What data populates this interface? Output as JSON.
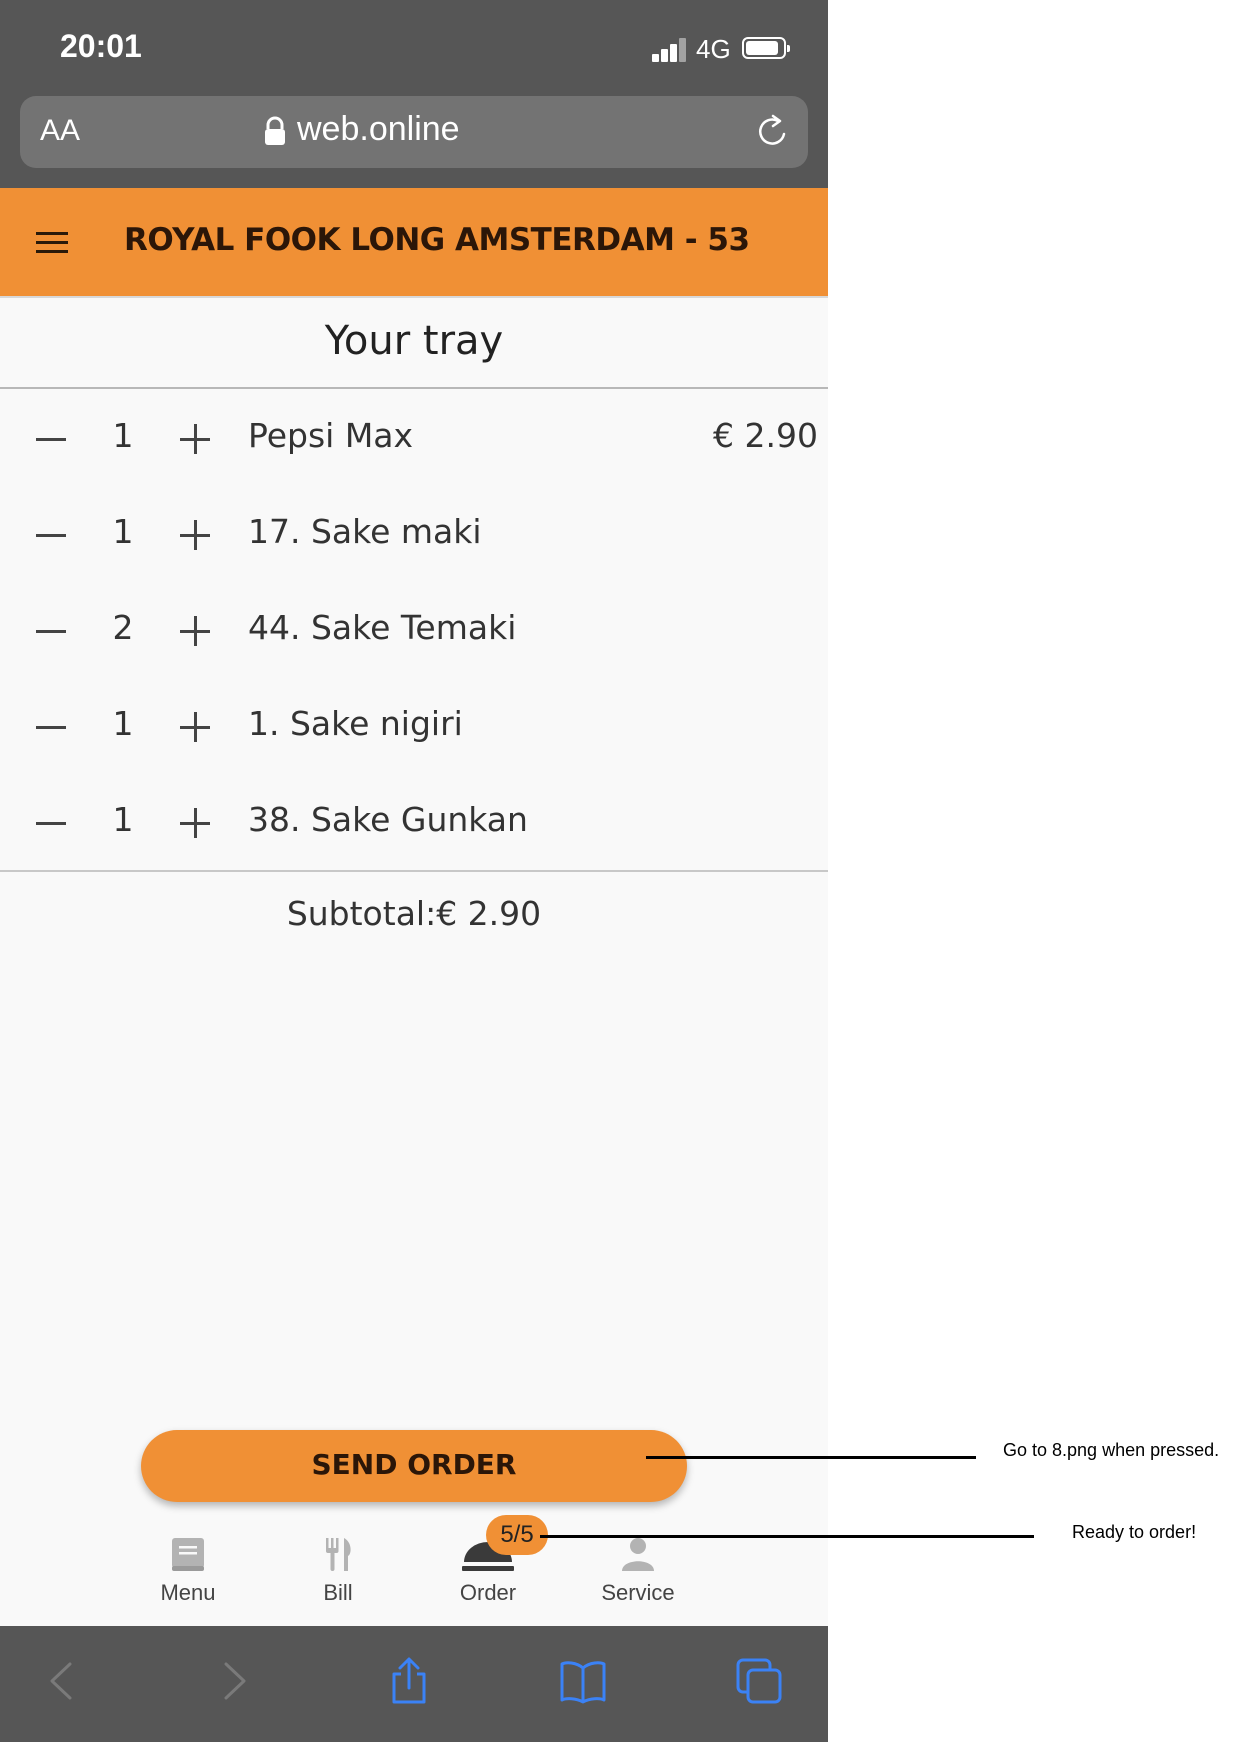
{
  "status_bar": {
    "time": "20:01",
    "network": "4G"
  },
  "browser": {
    "text_size_label": "AA",
    "url": "web.online"
  },
  "header": {
    "title": "ROYAL FOOK LONG AMSTERDAM - 53"
  },
  "tray": {
    "title": "Your tray",
    "items": [
      {
        "qty": "1",
        "name": "Pepsi Max",
        "price": "€ 2.90"
      },
      {
        "qty": "1",
        "name": "17. Sake maki",
        "price": ""
      },
      {
        "qty": "2",
        "name": "44. Sake Temaki",
        "price": ""
      },
      {
        "qty": "1",
        "name": "1. Sake nigiri",
        "price": ""
      },
      {
        "qty": "1",
        "name": "38. Sake Gunkan",
        "price": ""
      }
    ],
    "subtotal": "Subtotal:€ 2.90"
  },
  "send_button_label": "SEND ORDER",
  "bottom_nav": {
    "menu": "Menu",
    "bill": "Bill",
    "order": "Order",
    "service": "Service",
    "order_badge": "5/5"
  },
  "annotations": {
    "send_note": "Go to 8.png when pressed.",
    "badge_note": "Ready to order!"
  },
  "colors": {
    "accent": "#f09035",
    "chrome": "#565656",
    "ios_blue": "#3b82f6"
  }
}
